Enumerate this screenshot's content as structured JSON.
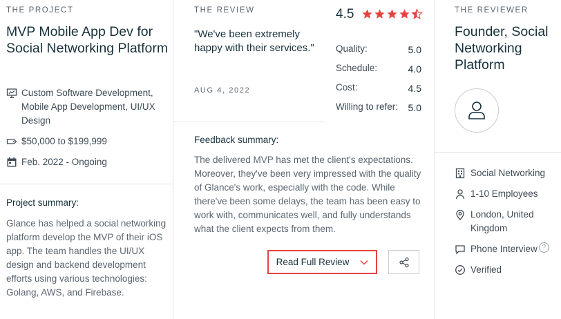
{
  "project": {
    "eyebrow": "THE PROJECT",
    "title": "MVP Mobile App Dev for Social Networking Platform",
    "service_lines": "Custom Software Development, Mobile App Development, UI/UX Design",
    "budget": "$50,000 to $199,999",
    "timeline": "Feb. 2022 - Ongoing",
    "summary_label": "Project summary:",
    "summary_text": "Glance has helped a social networking platform develop the MVP of their iOS app. The team handles the UI/UX design and backend development efforts using various technologies: Golang, AWS, and Firebase."
  },
  "review": {
    "eyebrow": "THE REVIEW",
    "quote": "\"We've been extremely happy with their services.\"",
    "date": "AUG 4, 2022",
    "rating": "4.5",
    "stars": 4.5,
    "scores": [
      {
        "label": "Quality:",
        "value": "5.0"
      },
      {
        "label": "Schedule:",
        "value": "4.0"
      },
      {
        "label": "Cost:",
        "value": "4.5"
      },
      {
        "label": "Willing to refer:",
        "value": "5.0"
      }
    ],
    "feedback_label": "Feedback summary:",
    "feedback_text": "The delivered MVP has met the client's expectations. Moreover, they've been very impressed with the quality of Glance's work, especially with the code. While there've been some delays, the team has been easy to work with, communicates well, and fully understands what the client expects from them.",
    "read_full_label": "Read Full Review"
  },
  "reviewer": {
    "eyebrow": "THE REVIEWER",
    "title": "Founder, Social Networking Platform",
    "industry": "Social Networking",
    "employees": "1-10 Employees",
    "location": "London, United Kingdom",
    "interview": "Phone Interview",
    "help_glyph": "?",
    "verified": "Verified"
  },
  "colors": {
    "star": "#e8423f",
    "button_border": "#e8423f",
    "text_dark": "#17313b",
    "text_muted": "#5b6670",
    "divider": "#e3e6e8"
  }
}
